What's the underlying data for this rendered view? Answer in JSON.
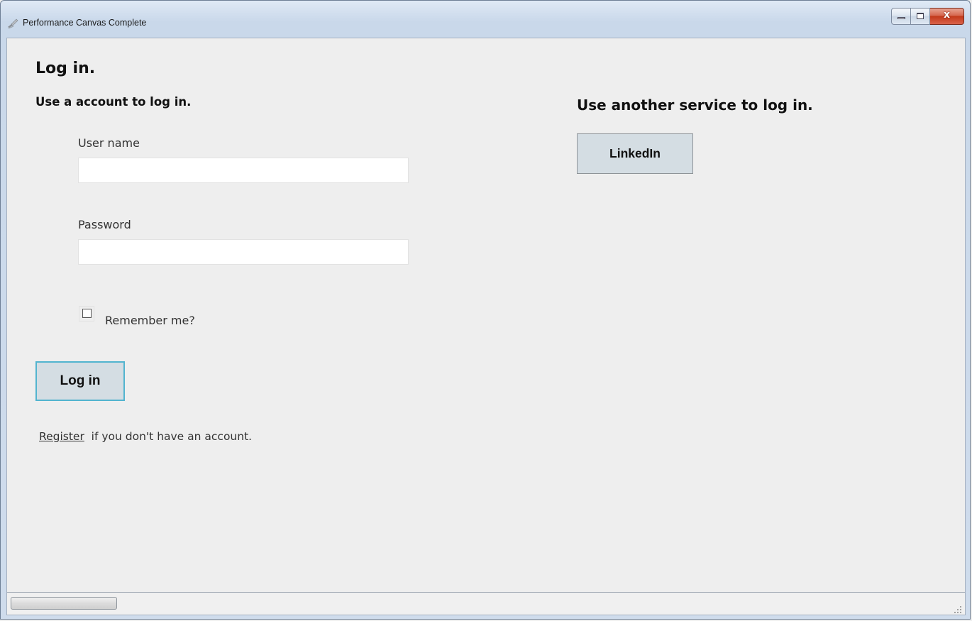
{
  "window": {
    "title": "Performance Canvas Complete",
    "icon": "app-brush-icon"
  },
  "caption_buttons": {
    "minimize_icon": "minimize-icon",
    "maximize_icon": "maximize-icon",
    "close_icon": "close-icon",
    "close_glyph": "x",
    "close_color": "#c2391a"
  },
  "login": {
    "title": "Log in.",
    "subtitle": "Use a account to log in.",
    "username_label": "User name",
    "username_value": "",
    "password_label": "Password",
    "password_value": "",
    "remember_label": "Remember me?",
    "remember_checked": false,
    "submit_label": "Log in",
    "register_link": "Register",
    "register_text": "  if you don't have an account."
  },
  "external": {
    "title": "Use another service to log in.",
    "providers": [
      {
        "label": "LinkedIn"
      }
    ]
  },
  "colors": {
    "content_bg": "#eeeeee",
    "button_bg": "#d4dde3",
    "focus_border": "#52b4cf"
  }
}
